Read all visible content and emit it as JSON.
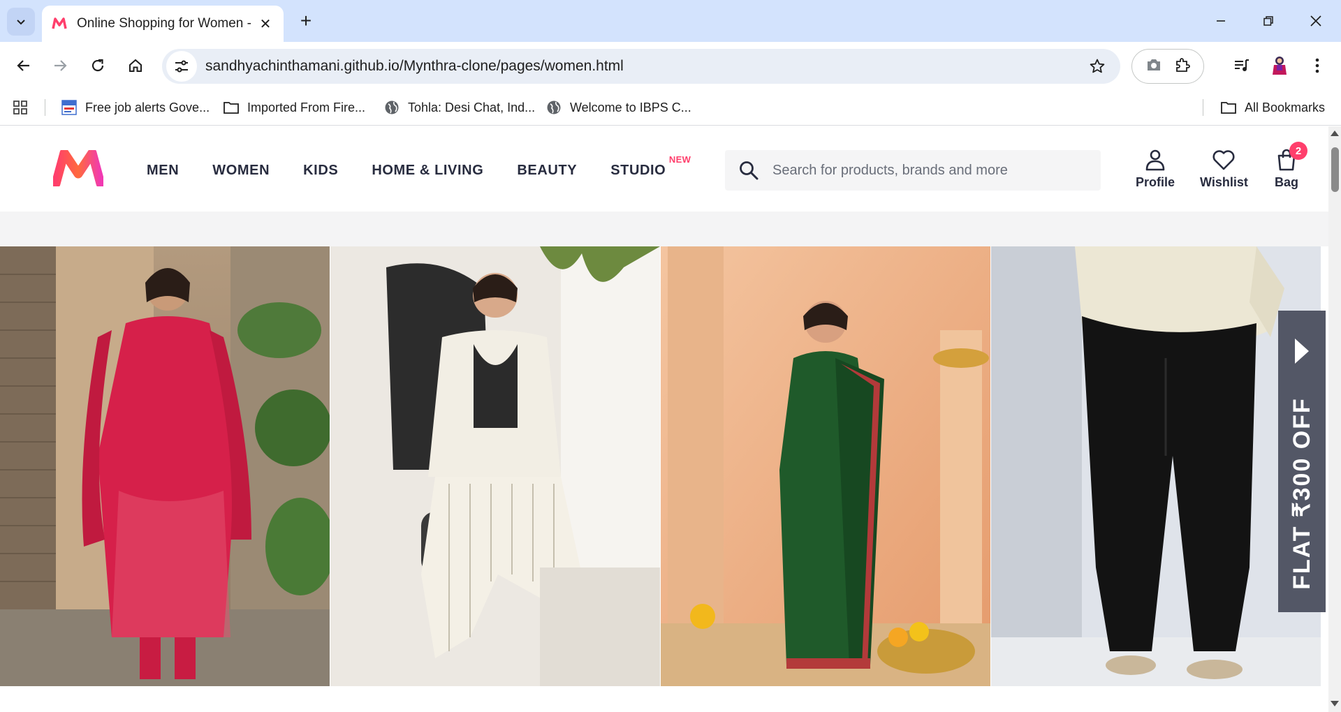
{
  "browser": {
    "tab_title": "Online Shopping for Women - S",
    "url": "sandhyachinthamani.github.io/Mynthra-clone/pages/women.html",
    "bookmarks": [
      {
        "label": "Free job alerts Gove...",
        "icon": "jobs-favicon"
      },
      {
        "label": "Imported From Fire...",
        "icon": "folder-icon"
      },
      {
        "label": "Tohla: Desi Chat, Ind...",
        "icon": "globe-icon"
      },
      {
        "label": "Welcome to IBPS C...",
        "icon": "globe-icon"
      }
    ],
    "all_bookmarks": "All Bookmarks"
  },
  "site": {
    "brand_color": "#ff3f6c",
    "nav": [
      {
        "label": "MEN"
      },
      {
        "label": "WOMEN"
      },
      {
        "label": "KIDS"
      },
      {
        "label": "HOME & LIVING"
      },
      {
        "label": "BEAUTY"
      },
      {
        "label": "STUDIO",
        "badge": "NEW"
      }
    ],
    "search_placeholder": "Search for products, brands and more",
    "actions": {
      "profile": "Profile",
      "wishlist": "Wishlist",
      "bag": "Bag",
      "bag_count": "2"
    },
    "banner": {
      "panels": [
        {
          "desc": "woman in red printed kurta set with dupatta"
        },
        {
          "desc": "woman in white pinstripe co-ord blazer set on chair"
        },
        {
          "desc": "woman in green embroidered saree"
        },
        {
          "desc": "model in black trousers and cream shirt"
        }
      ]
    },
    "offer": "FLAT ₹300 OFF"
  }
}
